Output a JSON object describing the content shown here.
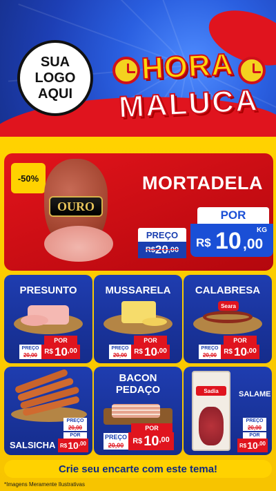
{
  "header": {
    "logo_placeholder": [
      "SUA",
      "LOGO",
      "AQUI"
    ],
    "title_line1": "HORA",
    "title_line2": "MALUCA"
  },
  "featured": {
    "discount_badge": "-50%",
    "product_name": "MORTADELA",
    "brand_label": "OURO",
    "old_price_label": "PREÇO",
    "old_price_currency": "R$",
    "old_price_int": "20",
    "old_price_dec": ",00",
    "new_price_label": "POR",
    "new_price_currency": "R$",
    "new_price_int": "10",
    "new_price_dec": ",00",
    "unit": "KG"
  },
  "products": [
    {
      "name": "PRESUNTO",
      "preco_label": "PREÇO",
      "old_price": "20,00",
      "por_label": "POR",
      "currency": "R$",
      "new_int": "10",
      "new_dec": ",00",
      "unit": "KG"
    },
    {
      "name": "MUSSARELA",
      "preco_label": "PREÇO",
      "old_price": "20,00",
      "por_label": "POR",
      "currency": "R$",
      "new_int": "10",
      "new_dec": ",00",
      "unit": "KG"
    },
    {
      "name": "CALABRESA",
      "brand": "Seara",
      "preco_label": "PREÇO",
      "old_price": "20,00",
      "por_label": "POR",
      "currency": "R$",
      "new_int": "10",
      "new_dec": ",00",
      "unit": "KG"
    },
    {
      "name": "SALSICHA",
      "preco_label": "PREÇO",
      "old_price": "20,00",
      "por_label": "POR",
      "currency": "R$",
      "new_int": "10",
      "new_dec": ",00",
      "unit": "KG"
    },
    {
      "name_line1": "BACON",
      "name_line2": "PEDAÇO",
      "preco_label": "PREÇO",
      "old_price": "20,00",
      "por_label": "POR",
      "currency": "R$",
      "new_int": "10",
      "new_dec": ",00",
      "unit": "KG"
    },
    {
      "name": "SALAME",
      "brand": "Sadia",
      "preco_label": "PREÇO",
      "old_price": "20,00",
      "por_label": "POR",
      "currency": "R$",
      "new_int": "10",
      "new_dec": ",00",
      "unit": "UNID"
    }
  ],
  "footer": {
    "cta": "Crie seu encarte com este tema!",
    "disclaimer": "*Imagens Meramente Ilustrativas"
  },
  "colors": {
    "brand_blue": "#1f3fb0",
    "brand_red": "#e0141e",
    "brand_yellow": "#ffd200"
  }
}
